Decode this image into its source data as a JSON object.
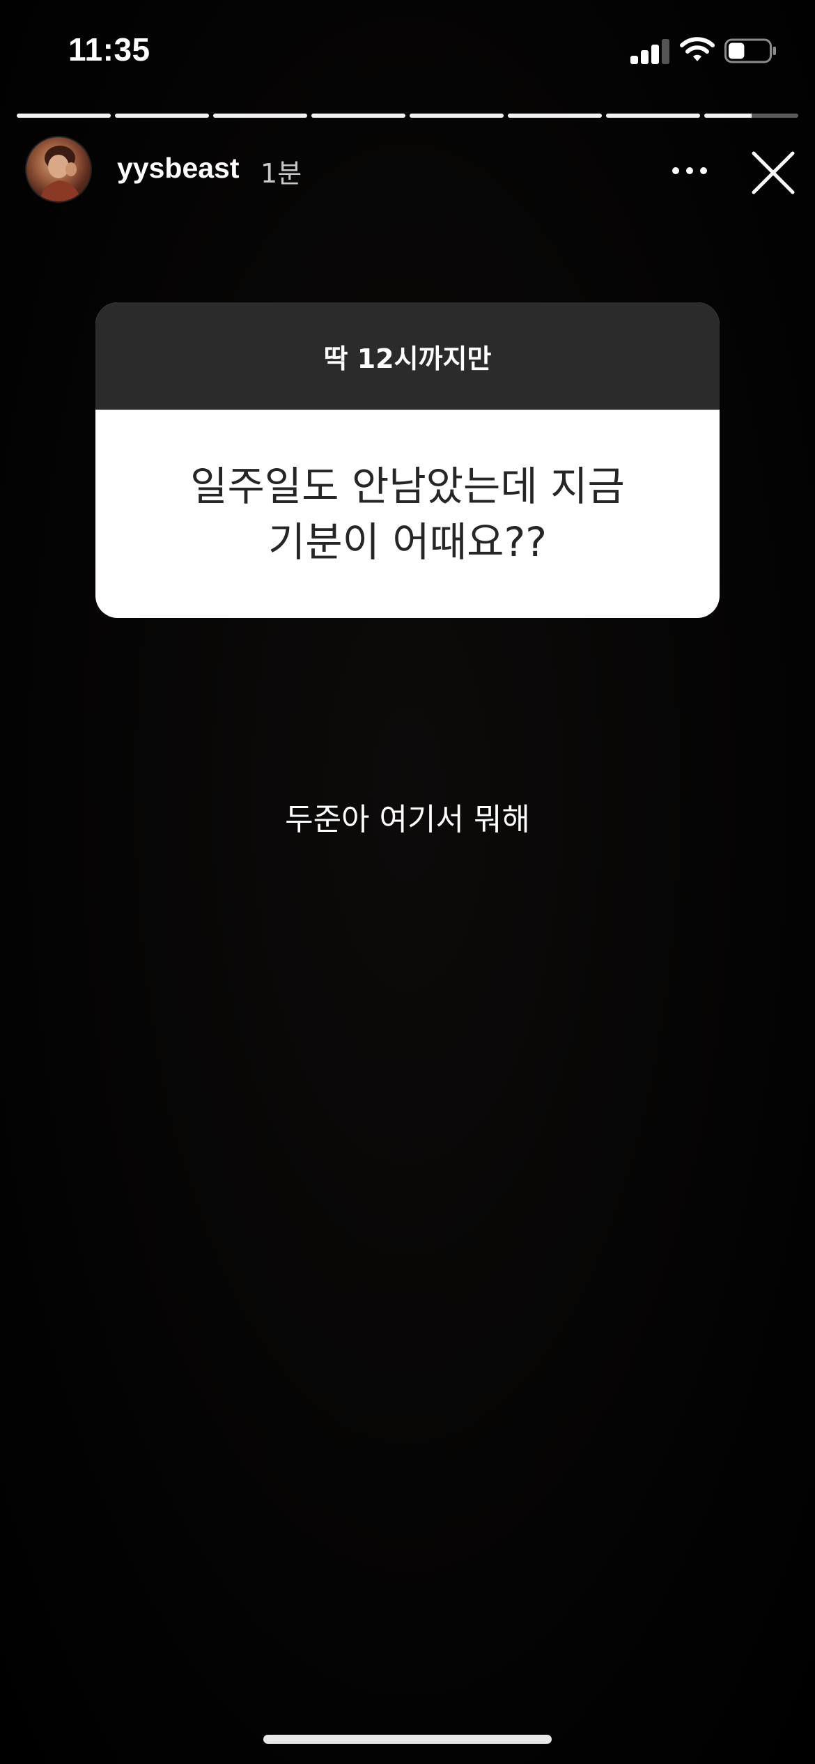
{
  "status_bar": {
    "time": "11:35",
    "signal_icon": "cellular-signal-icon",
    "wifi_icon": "wifi-icon",
    "battery_icon": "battery-icon",
    "battery_level": 0.4
  },
  "story": {
    "segments_total": 8,
    "segments_completed": 7,
    "current_segment_progress": 0.5,
    "username": "yysbeast",
    "time_ago": "1분",
    "more_icon": "more-horizontal-icon",
    "close_icon": "close-icon"
  },
  "question_sticker": {
    "title": "딱 12시까지만",
    "question_lines": [
      "일주일도 안남았는데 지금",
      "기분이 어때요??"
    ]
  },
  "answer": {
    "text": "두준아 여기서 뭐해"
  }
}
